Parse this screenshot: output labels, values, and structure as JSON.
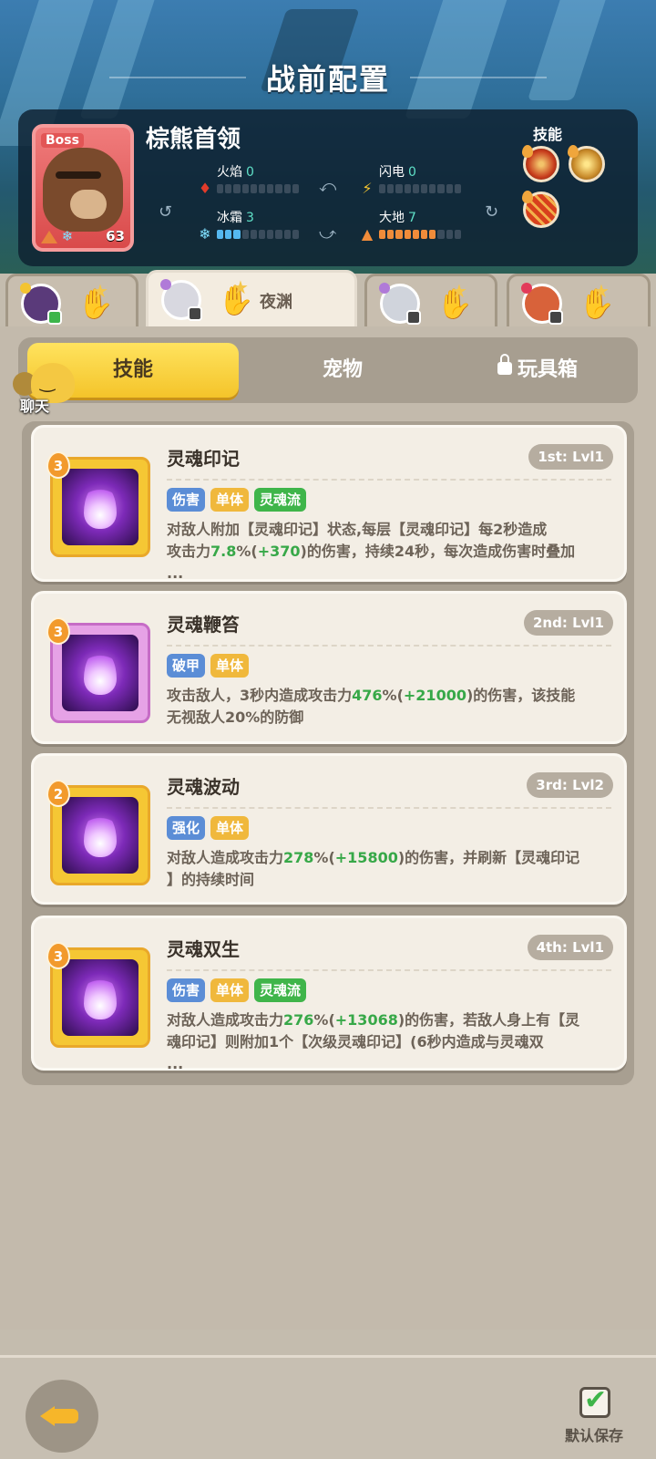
{
  "header": {
    "title": "战前配置"
  },
  "boss": {
    "tag": "Boss",
    "name": "棕熊首领",
    "level": "63",
    "stats": [
      {
        "label": "火焰",
        "value": "0",
        "icon": "fire-icon",
        "filled": 0
      },
      {
        "label": "闪电",
        "value": "0",
        "icon": "lightning-icon",
        "filled": 0
      },
      {
        "label": "冰霜",
        "value": "3",
        "icon": "snowflake-icon",
        "filled": 3
      },
      {
        "label": "大地",
        "value": "7",
        "icon": "earth-icon",
        "filled": 7
      }
    ],
    "skills_label": "技能"
  },
  "hero_tabs": [
    {
      "name": "",
      "active": false
    },
    {
      "name": "夜渊",
      "active": true
    },
    {
      "name": "",
      "active": false
    },
    {
      "name": "",
      "active": false
    }
  ],
  "segments": {
    "skills": "技能",
    "pets": "宠物",
    "toybox": "玩具箱"
  },
  "chat": {
    "label": "聊天"
  },
  "cards": [
    {
      "tier": "3",
      "name": "灵魂印记",
      "level": "1st: Lvl1",
      "tags": [
        {
          "text": "伤害",
          "color": "blue"
        },
        {
          "text": "单体",
          "color": "yellow"
        },
        {
          "text": "灵魂流",
          "color": "green"
        }
      ],
      "desc_lines": [
        [
          {
            "t": "对敌人附加【灵魂印记】状态,每层【灵魂印记】每2秒造成"
          }
        ],
        [
          {
            "t": "攻击力"
          },
          {
            "t": "7.8",
            "g": true
          },
          {
            "t": "%("
          },
          {
            "t": "+370",
            "g": true
          },
          {
            "t": ")的伤害，持续24秒，每次造成伤害时叠加"
          }
        ],
        [
          {
            "t": "..."
          }
        ]
      ]
    },
    {
      "tier": "3",
      "name": "灵魂鞭笞",
      "level": "2nd: Lvl1",
      "tags": [
        {
          "text": "破甲",
          "color": "blue"
        },
        {
          "text": "单体",
          "color": "yellow"
        }
      ],
      "desc_lines": [
        [
          {
            "t": "攻击敌人，3秒内造成攻击力"
          },
          {
            "t": "476",
            "g": true
          },
          {
            "t": "%("
          },
          {
            "t": "+21000",
            "g": true
          },
          {
            "t": ")的伤害，该技能"
          }
        ],
        [
          {
            "t": "无视敌人20%的防御"
          }
        ]
      ]
    },
    {
      "tier": "2",
      "name": "灵魂波动",
      "level": "3rd: Lvl2",
      "tags": [
        {
          "text": "强化",
          "color": "blue"
        },
        {
          "text": "单体",
          "color": "yellow"
        }
      ],
      "desc_lines": [
        [
          {
            "t": "对敌人造成攻击力"
          },
          {
            "t": "278",
            "g": true
          },
          {
            "t": "%("
          },
          {
            "t": "+15800",
            "g": true
          },
          {
            "t": ")的伤害，并刷新【灵魂印记"
          }
        ],
        [
          {
            "t": "】的持续时间"
          }
        ]
      ]
    },
    {
      "tier": "3",
      "name": "灵魂双生",
      "level": "4th: Lvl1",
      "tags": [
        {
          "text": "伤害",
          "color": "blue"
        },
        {
          "text": "单体",
          "color": "yellow"
        },
        {
          "text": "灵魂流",
          "color": "green"
        }
      ],
      "desc_lines": [
        [
          {
            "t": "对敌人造成攻击力"
          },
          {
            "t": "276",
            "g": true
          },
          {
            "t": "%("
          },
          {
            "t": "+13068",
            "g": true
          },
          {
            "t": ")的伤害，若敌人身上有【灵"
          }
        ],
        [
          {
            "t": "魂印记】则附加1个【次级灵魂印记】(6秒内造成与灵魂双"
          }
        ],
        [
          {
            "t": "..."
          }
        ]
      ]
    }
  ],
  "footer": {
    "save_label": "默认保存"
  }
}
